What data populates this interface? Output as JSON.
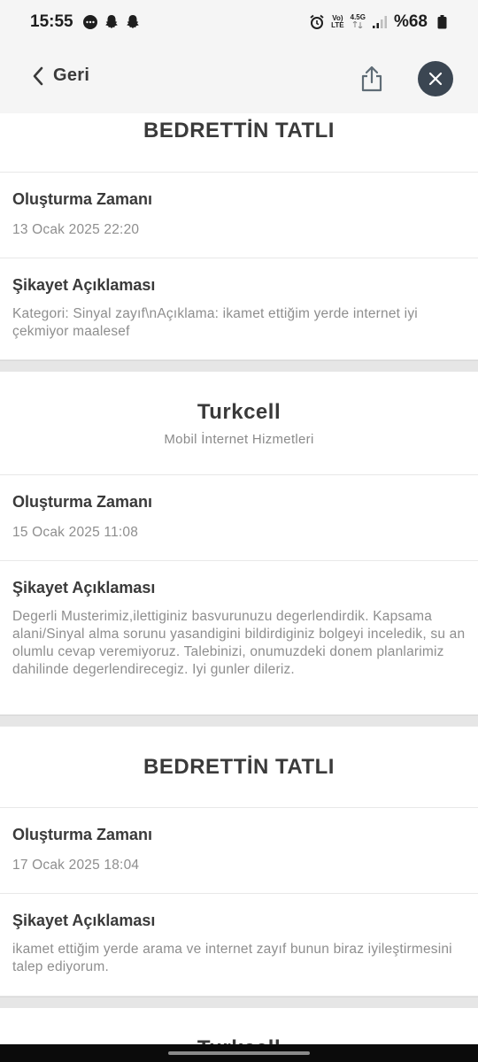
{
  "status_bar": {
    "time": "15:55",
    "net_top": "Vo)",
    "net_bottom": "LTE",
    "gen_top": "4.5G",
    "battery": "%68"
  },
  "topbar": {
    "back_label": "Geri"
  },
  "cards": [
    {
      "title": "BEDRETTİN TATLI",
      "subtitle": "",
      "time_label": "Oluşturma Zamanı",
      "time_value": "13 Ocak 2025 22:20",
      "desc_label": "Şikayet Açıklaması",
      "desc_value": "Kategori: Sinyal zayıf\\nAçıklama: ikamet ettiğim yerde internet iyi çekmiyor maalesef"
    },
    {
      "title": "Turkcell",
      "subtitle": "Mobil İnternet Hizmetleri",
      "time_label": "Oluşturma Zamanı",
      "time_value": "15 Ocak 2025 11:08",
      "desc_label": "Şikayet Açıklaması",
      "desc_value": "Degerli Musterimiz,ilettiginiz basvurunuzu degerlendirdik. Kapsama alani/Sinyal alma sorunu yasandigini bildirdiginiz bolgeyi inceledik, su an olumlu cevap veremiyoruz. Talebinizi, onumuzdeki donem planlarimiz dahilinde degerlendirecegiz. Iyi gunler dileriz."
    },
    {
      "title": "BEDRETTİN TATLI",
      "subtitle": "",
      "time_label": "Oluşturma Zamanı",
      "time_value": "17 Ocak 2025 18:04",
      "desc_label": "Şikayet Açıklaması",
      "desc_value": "ikamet ettiğim yerde arama ve internet zayıf bunun biraz iyileştirmesini talep ediyorum."
    },
    {
      "title": "Turkcell"
    }
  ],
  "colors": {
    "close_button": "#3b4652",
    "title_text": "#3a3a3a",
    "muted_text": "#8e8e8e",
    "separator": "#e6e6e6"
  }
}
